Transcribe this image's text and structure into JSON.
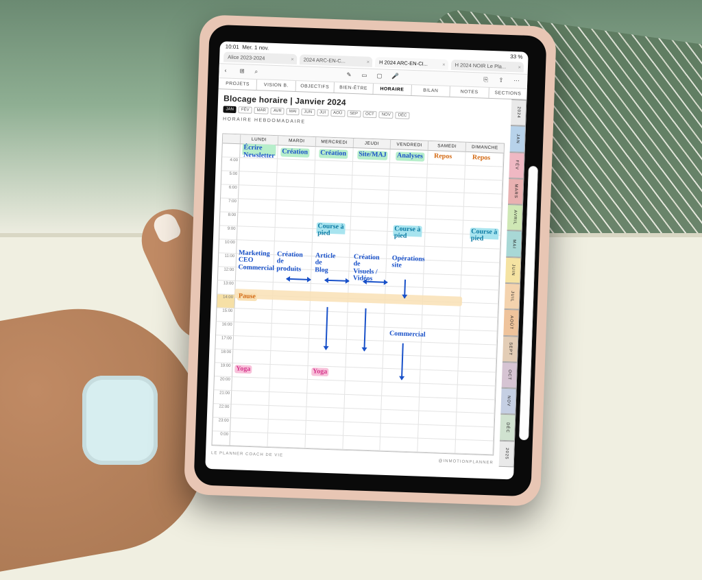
{
  "status": {
    "time": "10:01",
    "date": "Mer. 1 nov.",
    "battery": "33 %"
  },
  "tabs": [
    {
      "label": "Alice 2023-2024"
    },
    {
      "label": "2024 ARC-EN-C..."
    },
    {
      "label": "H 2024 ARC-EN-CI..."
    },
    {
      "label": "H 2024 NOIR Le Pla..."
    }
  ],
  "active_tab_index": 2,
  "toolbar_icons": {
    "back": "‹",
    "grid": "⊞",
    "search": "⌕",
    "pencil": "✎",
    "lasso": "▭",
    "eraser": "▢",
    "mic": "🎤",
    "note": "⎘",
    "share": "⇪",
    "more": "⋯"
  },
  "section_tabs": [
    "PROJETS",
    "VISION B.",
    "OBJECTIFS",
    "BIEN-ÊTRE",
    "HORAIRE",
    "BILAN",
    "NOTES",
    "SECTIONS"
  ],
  "active_section_index": 4,
  "page_title": "Blocage horaire | Janvier 2024",
  "months": [
    "JAN",
    "FÉV",
    "MAR",
    "AVR",
    "MAI",
    "JUN",
    "JUI",
    "AOÛ",
    "SEP",
    "OCT",
    "NOV",
    "DÉC"
  ],
  "selected_month_index": 0,
  "subheading": "HORAIRE HEBDOMADAIRE",
  "day_headers": [
    "",
    "LUNDI",
    "MARDI",
    "MERCREDI",
    "JEUDI",
    "VENDREDI",
    "SAMEDI",
    "DIMANCHE"
  ],
  "time_labels": [
    "4:00",
    "5:00",
    "6:00",
    "7:00",
    "8:00",
    "9:00",
    "10:00",
    "11:00",
    "12:00",
    "13:00",
    "14:00",
    "15:00",
    "16:00",
    "17:00",
    "18:00",
    "19:00",
    "20:00",
    "21:00",
    "22:00",
    "23:00",
    "0:00"
  ],
  "side_tabs": [
    "2024",
    "JAN",
    "FÉV",
    "MARS",
    "AVRIL",
    "MAI",
    "JUIN",
    "JUIL",
    "AOÛT",
    "SEPT",
    "OCT",
    "NOV",
    "DÉC",
    "2025"
  ],
  "side_tab_colors": [
    "#e9e9e9",
    "#b7d2ea",
    "#efb8c3",
    "#e9b1b1",
    "#cfe8b5",
    "#a8d8d6",
    "#f5e3a2",
    "#f4d3ae",
    "#efc39b",
    "#e3cdb6",
    "#d6c4d3",
    "#c5cfe3",
    "#d0e2d0",
    "#e9e9e9"
  ],
  "footer_left": "LE PLANNER COACH DE VIE",
  "footer_right": "@INMOTIONPLANNER",
  "handwriting": {
    "header_row": {
      "lundi": "Écrire\nNewsletter",
      "mardi": "Création",
      "mercredi": "Création",
      "jeudi": "Site/MAJ",
      "vendredi": "Analyses",
      "samedi": "Repos",
      "dimanche": "Repos"
    },
    "course": "Course à\npied",
    "midday": {
      "lundi": "Marketing\nCEO\nCommercial",
      "mardi": "Création\nde\nproduits",
      "mercredi": "Article\nde\nBlog",
      "jeudi": "Création\nde\nVisuels /\nVidéos",
      "vendredi": "Opérations\nsite"
    },
    "pause": "Pause",
    "commercial": "Commercial",
    "yoga": "Yoga"
  }
}
